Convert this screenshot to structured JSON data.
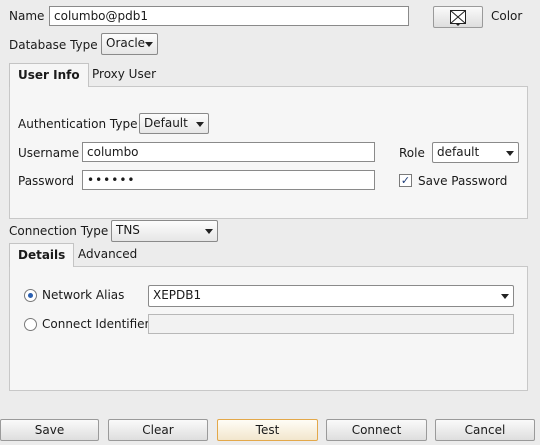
{
  "connection": {
    "name_label": "Name",
    "name_value": "columbo@pdb1",
    "color_label": "Color",
    "dbtype_label": "Database Type",
    "dbtype_value": "Oracle"
  },
  "auth_tabs": {
    "user_info": "User Info",
    "proxy_user": "Proxy User"
  },
  "user_info": {
    "auth_type_label": "Authentication Type",
    "auth_type_value": "Default",
    "username_label": "Username",
    "username_value": "columbo",
    "password_label": "Password",
    "password_value": "••••••",
    "role_label": "Role",
    "role_value": "default",
    "save_password_label": "Save Password",
    "save_password_checked": true
  },
  "connection_type": {
    "label": "Connection Type",
    "value": "TNS"
  },
  "detail_tabs": {
    "details": "Details",
    "advanced": "Advanced"
  },
  "details": {
    "network_alias_label": "Network Alias",
    "network_alias_value": "XEPDB1",
    "connect_identifier_label": "Connect Identifier",
    "connect_identifier_value": ""
  },
  "buttons": {
    "save": "Save",
    "clear": "Clear",
    "test": "Test",
    "connect": "Connect",
    "cancel": "Cancel"
  }
}
